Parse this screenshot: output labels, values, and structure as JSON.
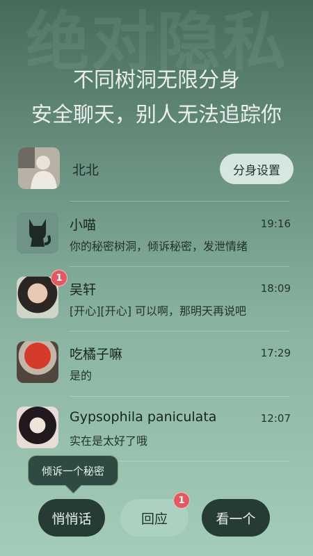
{
  "background": {
    "watermark": "绝对隐私"
  },
  "hero": {
    "line1": "不同树洞无限分身",
    "line2": "安全聊天，别人无法追踪你"
  },
  "me": {
    "name": "北北",
    "clone_settings_label": "分身设置"
  },
  "chats": [
    {
      "name": "小喵",
      "time": "19:16",
      "message": "你的秘密树洞，倾诉秘密，发泄情绪",
      "unread": "",
      "avatar_icon": "cat-icon"
    },
    {
      "name": "吴轩",
      "time": "18:09",
      "message": "[开心][开心] 可以啊，那明天再说吧",
      "unread": "1",
      "avatar_icon": ""
    },
    {
      "name": "吃橘子嘛",
      "time": "17:29",
      "message": "是的",
      "unread": "",
      "avatar_icon": ""
    },
    {
      "name": "Gypsophila paniculata",
      "time": "12:07",
      "message": "实在是太好了哦",
      "unread": "",
      "avatar_icon": ""
    }
  ],
  "tooltip": {
    "text": "倾诉一个秘密"
  },
  "bottom": {
    "whisper_label": "悄悄话",
    "reply_label": "回应",
    "reply_badge": "1",
    "look_label": "看一个"
  },
  "colors": {
    "badge": "#e05a5f",
    "dark_button": "#263b33",
    "accent_green": "#8bb5a2"
  }
}
